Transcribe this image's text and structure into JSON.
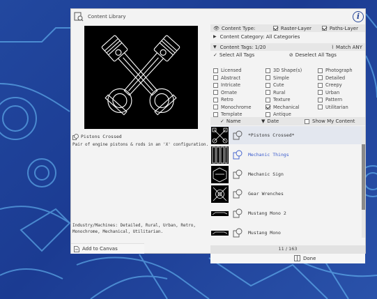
{
  "dialog": {
    "title": "Content Library",
    "info_icon": "info-icon"
  },
  "preview": {
    "name": "Pistons Crossed",
    "description": "Pair of engine pistons & rods in an 'X' configuration.",
    "tags_line": "Industry/Machines: Detailed, Rural, Urban, Retro, Monochrome, Mechanical, Utilitarian.",
    "add_label": "Add to Canvas"
  },
  "filters": {
    "content_type_label": "Content Type:",
    "raster_label": "Raster-Layer",
    "raster_checked": true,
    "paths_label": "Paths-Layer",
    "paths_checked": true,
    "category_label": "Content Category: All Categories",
    "tags_label": "Content Tags: 1/20",
    "match_label": "Match ANY",
    "select_all": "Select All Tags",
    "deselect_all": "Deselect All Tags",
    "tags": [
      {
        "label": "Licensed",
        "checked": false
      },
      {
        "label": "3D Shape(s)",
        "checked": false
      },
      {
        "label": "Photograph",
        "checked": false
      },
      {
        "label": "Abstract",
        "checked": false
      },
      {
        "label": "Simple",
        "checked": false
      },
      {
        "label": "Detailed",
        "checked": false
      },
      {
        "label": "Intricate",
        "checked": false
      },
      {
        "label": "Cute",
        "checked": false
      },
      {
        "label": "Creepy",
        "checked": false
      },
      {
        "label": "Ornate",
        "checked": false
      },
      {
        "label": "Rural",
        "checked": false
      },
      {
        "label": "Urban",
        "checked": false
      },
      {
        "label": "Retro",
        "checked": false
      },
      {
        "label": "Texture",
        "checked": false
      },
      {
        "label": "Pattern",
        "checked": false
      },
      {
        "label": "Monochrome",
        "checked": false
      },
      {
        "label": "Mechanical",
        "checked": true
      },
      {
        "label": "Utilitarian",
        "checked": false
      },
      {
        "label": "Template",
        "checked": false
      },
      {
        "label": "Antique",
        "checked": false
      }
    ]
  },
  "sort": {
    "name_label": "Name",
    "date_label": "Date",
    "show_mine_label": "Show My Content"
  },
  "items": [
    {
      "label": "*Pistons Crossed*"
    },
    {
      "label": "Mechanic Things"
    },
    {
      "label": "Mechanic Sign"
    },
    {
      "label": "Gear Wrenches"
    },
    {
      "label": "Mustang Mono 2"
    },
    {
      "label": "Mustang Mono"
    }
  ],
  "pager": {
    "text": "11 / 163"
  },
  "done_label": "Done",
  "colors": {
    "accent": "#3a5bcc",
    "background": "#1f3f9a",
    "panel": "#f3f3f3"
  }
}
